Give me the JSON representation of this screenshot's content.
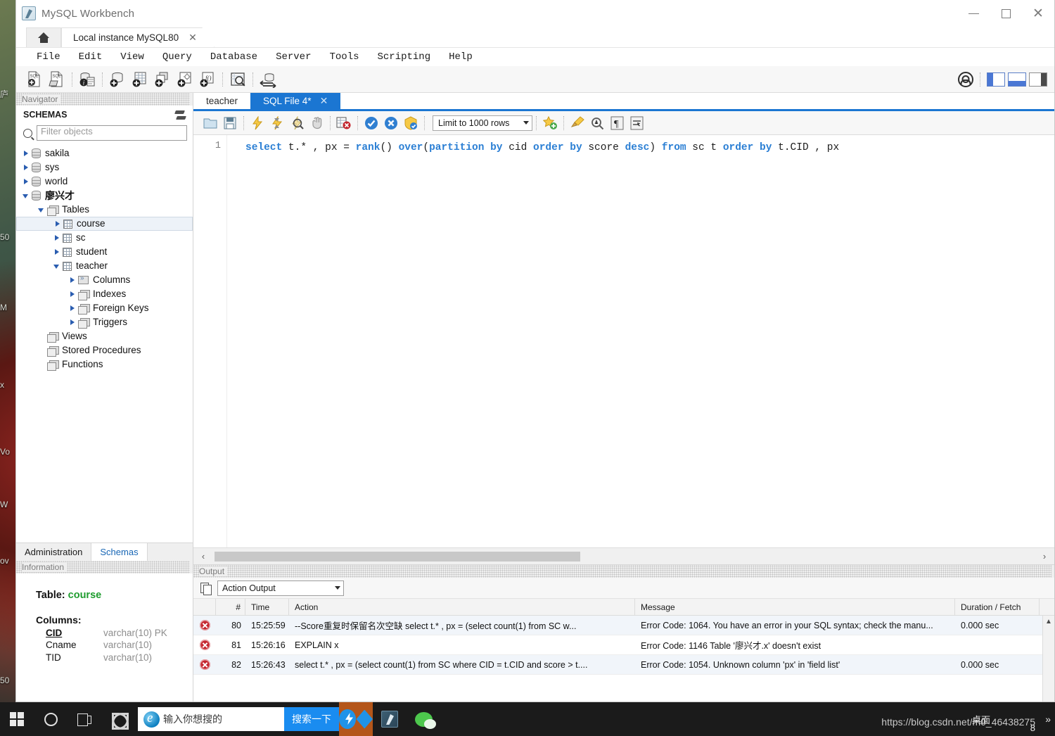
{
  "window": {
    "title": "MySQL Workbench",
    "app_icon": "dolphin-icon",
    "controls": {
      "minimize": "–",
      "maximize": "▢",
      "close": "✕"
    }
  },
  "tabs": {
    "home_icon": "home-icon",
    "instance_tab": "Local instance MySQL80",
    "close_glyph": "✕"
  },
  "menu": {
    "items": [
      "File",
      "Edit",
      "View",
      "Query",
      "Database",
      "Server",
      "Tools",
      "Scripting",
      "Help"
    ]
  },
  "main_toolbar": {
    "icons": [
      "new-sql-tab-icon",
      "open-sql-script-icon",
      "connection-info-icon",
      "new-schema-icon",
      "new-table-icon",
      "new-view-icon",
      "new-stored-procedure-icon",
      "new-function-icon",
      "search-data-icon",
      "reconnect-server-icon"
    ],
    "right_icons": [
      "user-account-icon",
      "toggle-sidebar-icon",
      "toggle-output-icon",
      "toggle-secondary-sidebar-icon"
    ]
  },
  "navigator": {
    "caption": "Navigator",
    "section_title": "SCHEMAS",
    "refresh_icon": "refresh-icon",
    "filter": {
      "placeholder": "Filter objects",
      "value": "",
      "icon": "search-icon"
    },
    "tree": [
      {
        "label": "sakila",
        "icon": "schema-icon",
        "depth": 0,
        "state": "closed",
        "selected": false,
        "bold": false
      },
      {
        "label": "sys",
        "icon": "schema-icon",
        "depth": 0,
        "state": "closed",
        "selected": false,
        "bold": false
      },
      {
        "label": "world",
        "icon": "schema-icon",
        "depth": 0,
        "state": "closed",
        "selected": false,
        "bold": false
      },
      {
        "label": "廖兴才",
        "icon": "schema-icon",
        "depth": 0,
        "state": "open",
        "selected": false,
        "bold": true
      },
      {
        "label": "Tables",
        "icon": "folder-icon",
        "depth": 1,
        "state": "open",
        "selected": false,
        "bold": false
      },
      {
        "label": "course",
        "icon": "table-icon",
        "depth": 2,
        "state": "closed",
        "selected": true,
        "bold": false
      },
      {
        "label": "sc",
        "icon": "table-icon",
        "depth": 2,
        "state": "closed",
        "selected": false,
        "bold": false
      },
      {
        "label": "student",
        "icon": "table-icon",
        "depth": 2,
        "state": "closed",
        "selected": false,
        "bold": false
      },
      {
        "label": "teacher",
        "icon": "table-icon",
        "depth": 2,
        "state": "open",
        "selected": false,
        "bold": false
      },
      {
        "label": "Columns",
        "icon": "columns-icon",
        "depth": 3,
        "state": "closed",
        "selected": false,
        "bold": false
      },
      {
        "label": "Indexes",
        "icon": "folder-icon",
        "depth": 3,
        "state": "closed",
        "selected": false,
        "bold": false
      },
      {
        "label": "Foreign Keys",
        "icon": "folder-icon",
        "depth": 3,
        "state": "closed",
        "selected": false,
        "bold": false
      },
      {
        "label": "Triggers",
        "icon": "folder-icon",
        "depth": 3,
        "state": "closed",
        "selected": false,
        "bold": false
      },
      {
        "label": "Views",
        "icon": "folder-icon",
        "depth": 1,
        "state": "none",
        "selected": false,
        "bold": false
      },
      {
        "label": "Stored Procedures",
        "icon": "folder-icon",
        "depth": 1,
        "state": "none",
        "selected": false,
        "bold": false
      },
      {
        "label": "Functions",
        "icon": "folder-icon",
        "depth": 1,
        "state": "none",
        "selected": false,
        "bold": false
      }
    ],
    "bottom_tabs": [
      {
        "label": "Administration",
        "active": false
      },
      {
        "label": "Schemas",
        "active": true
      }
    ]
  },
  "information": {
    "caption": "Information",
    "table_label": "Table:",
    "table_name": "course",
    "columns_label": "Columns:",
    "columns": [
      {
        "name": "CID",
        "type": "varchar(10) PK",
        "pk": true
      },
      {
        "name": "Cname",
        "type": "varchar(10)",
        "pk": false
      },
      {
        "name": "TID",
        "type": "varchar(10)",
        "pk": false
      }
    ]
  },
  "editor": {
    "tabs": [
      {
        "label": "teacher",
        "active": false,
        "closable": false
      },
      {
        "label": "SQL File 4*",
        "active": true,
        "closable": true
      }
    ],
    "toolbar": {
      "icons": [
        "open-file-icon",
        "save-file-icon",
        "execute-icon",
        "execute-current-statement-icon",
        "explain-icon",
        "stop-icon",
        "toggle-stop-on-error-icon",
        "commit-icon",
        "rollback-icon",
        "autocommit-icon"
      ],
      "limit_label": "Limit to 1000 rows",
      "right_icons": [
        "snippets-icon",
        "beautify-sql-icon",
        "find-icon",
        "invisible-chars-icon",
        "wrap-lines-icon"
      ]
    },
    "line_numbers": [
      "1"
    ],
    "sql_tokens": [
      {
        "t": "select",
        "k": true
      },
      {
        "t": " t.* , px = ",
        "k": false
      },
      {
        "t": "rank",
        "k": true
      },
      {
        "t": "() ",
        "k": false
      },
      {
        "t": "over",
        "k": true
      },
      {
        "t": "(",
        "k": false
      },
      {
        "t": "partition",
        "k": true
      },
      {
        "t": " ",
        "k": false
      },
      {
        "t": "by",
        "k": true
      },
      {
        "t": " cid ",
        "k": false
      },
      {
        "t": "order",
        "k": true
      },
      {
        "t": " ",
        "k": false
      },
      {
        "t": "by",
        "k": true
      },
      {
        "t": " score ",
        "k": false
      },
      {
        "t": "desc",
        "k": true
      },
      {
        "t": ") ",
        "k": false
      },
      {
        "t": "from",
        "k": true
      },
      {
        "t": " sc t ",
        "k": false
      },
      {
        "t": "order",
        "k": true
      },
      {
        "t": " ",
        "k": false
      },
      {
        "t": "by",
        "k": true
      },
      {
        "t": " t.CID , px",
        "k": false
      }
    ],
    "sql_plain": "select t.* , px = rank() over(partition by cid order by score desc) from sc t order by t.CID , px",
    "hscroll": {
      "left_arrow": "‹",
      "right_arrow": "›"
    }
  },
  "output": {
    "caption": "Output",
    "copy_icon": "copy-icon",
    "mode": "Action Output",
    "headers": [
      "",
      "#",
      "Time",
      "Action",
      "Message",
      "Duration / Fetch"
    ],
    "rows": [
      {
        "status": "error",
        "num": "80",
        "time": "15:25:59",
        "action": "--Score重复时保留名次空缺  select t.* , px = (select count(1) from SC w...",
        "message": "Error Code: 1064. You have an error in your SQL syntax; check the manu...",
        "duration": "0.000 sec"
      },
      {
        "status": "error",
        "num": "81",
        "time": "15:26:16",
        "action": "EXPLAIN x",
        "message": "Error Code: 1146 Table '廖兴才.x' doesn't exist",
        "duration": ""
      },
      {
        "status": "error",
        "num": "82",
        "time": "15:26:43",
        "action": "select t.* , px = (select count(1) from SC where CID = t.CID and score > t....",
        "message": "Error Code: 1054. Unknown column 'px' in 'field list'",
        "duration": "0.000 sec"
      }
    ],
    "scroll_up_glyph": "▲"
  },
  "taskbar": {
    "start_icon": "windows-start-icon",
    "cortana_icon": "cortana-icon",
    "taskview_icon": "task-view-icon",
    "fan_icon": "fan-app-icon",
    "search": {
      "icon": "internet-explorer-icon",
      "placeholder": "输入你想搜的",
      "button_label": "搜索一下"
    },
    "apps": [
      {
        "name": "thunder-app-icon",
        "active": true
      },
      {
        "name": "mysql-workbench-app-icon",
        "active": true
      },
      {
        "name": "wechat-app-icon",
        "active": true
      }
    ],
    "tray": {
      "chevron": "»",
      "desktop_label": "桌面",
      "number": "8"
    }
  },
  "watermark": "https://blog.csdn.net/m0_46438275",
  "desktop_text": [
    "庐",
    "50",
    "M",
    "x",
    "Vo",
    "W",
    "ov",
    "50"
  ]
}
